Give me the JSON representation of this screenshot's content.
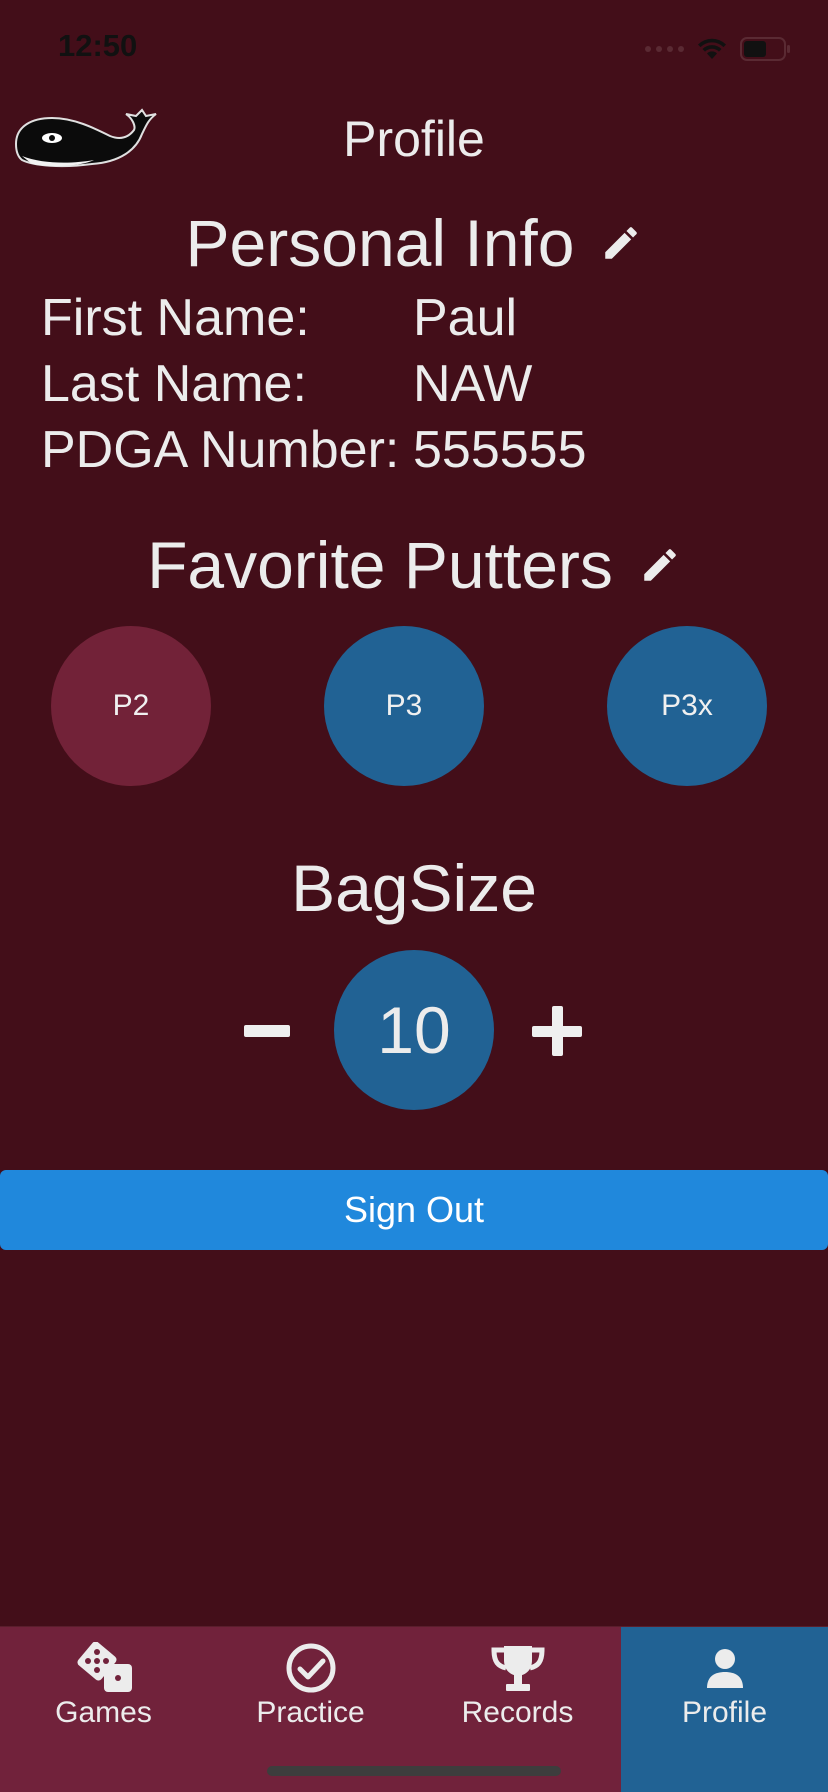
{
  "status_bar": {
    "time": "12:50"
  },
  "header": {
    "title": "Profile",
    "logo_icon": "whale-icon"
  },
  "personal_info": {
    "title": "Personal Info",
    "rows": [
      {
        "label": "First Name:",
        "value": "Paul"
      },
      {
        "label": "Last Name:",
        "value": "NAW"
      },
      {
        "label": "PDGA Number:",
        "value": "555555"
      }
    ]
  },
  "favorite_putters": {
    "title": "Favorite Putters",
    "items": [
      {
        "label": "P2",
        "color": "#722238"
      },
      {
        "label": "P3",
        "color": "#216294"
      },
      {
        "label": "P3x",
        "color": "#216294"
      }
    ]
  },
  "bag_size": {
    "title": "BagSize",
    "value": "10"
  },
  "sign_out": {
    "label": "Sign Out"
  },
  "tabs": [
    {
      "label": "Games",
      "icon": "dice-icon",
      "active": false
    },
    {
      "label": "Practice",
      "icon": "check-circle-icon",
      "active": false
    },
    {
      "label": "Records",
      "icon": "trophy-icon",
      "active": false
    },
    {
      "label": "Profile",
      "icon": "user-icon",
      "active": true
    }
  ],
  "colors": {
    "background": "#430e19",
    "accent_blue": "#216294",
    "accent_maroon": "#722238",
    "button_blue": "#2088dc"
  }
}
